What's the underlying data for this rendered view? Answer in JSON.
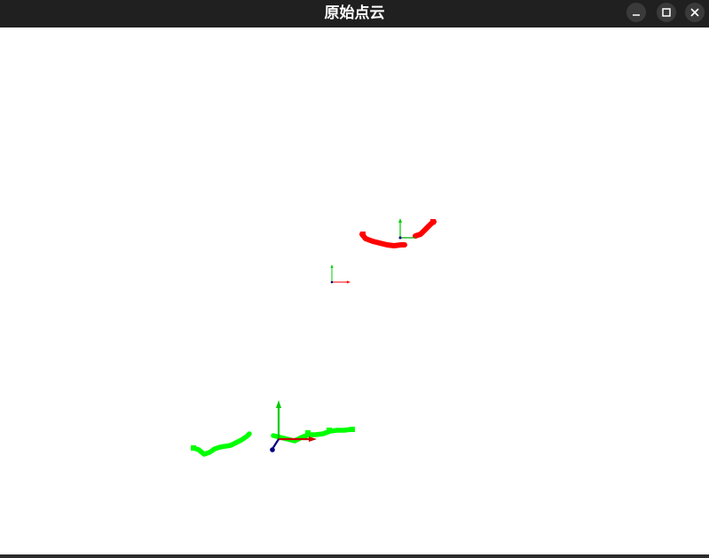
{
  "window": {
    "title": "原始点云",
    "controls": [
      "minimize-icon",
      "maximize-icon",
      "close-icon"
    ]
  },
  "viewport": {
    "background": "#ffffff",
    "clouds": [
      {
        "name": "red",
        "color": "#ff0000"
      },
      {
        "name": "green",
        "color": "#00ff00"
      }
    ],
    "axes_colors": {
      "x": "#ff0000",
      "y": "#00cc00",
      "z": "#000080"
    }
  }
}
